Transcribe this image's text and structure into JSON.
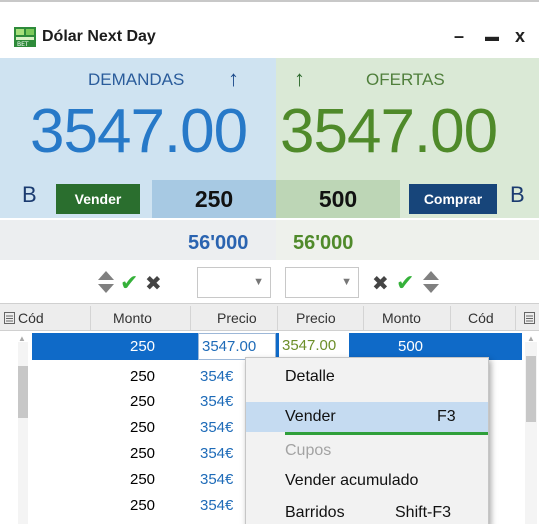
{
  "window": {
    "title": "Dólar Next Day",
    "icon": "bet-logo-icon",
    "minimize_icon": "minimize-icon",
    "maximize_icon": "maximize-icon",
    "close_icon": "close-icon",
    "minimize_glyph": "–",
    "maximize_glyph": "▬",
    "close_glyph": "x"
  },
  "bid": {
    "label": "DEMANDAS",
    "price": "3547.00",
    "badge": "B",
    "button": "Vender",
    "qty": "250",
    "total": "56'000",
    "color": "#2779c8"
  },
  "ask": {
    "label": "OFERTAS",
    "price": "3547.00",
    "badge": "B",
    "button": "Comprar",
    "qty": "500",
    "total": "56'000",
    "color": "#4f8a2a"
  },
  "controls": {
    "check_glyph": "✔",
    "x_glyph": "✖",
    "dropdown_glyph": "▼"
  },
  "grid": {
    "headers": {
      "cod_left": "Cód",
      "monto_left": "Monto",
      "precio_left": "Precio",
      "precio_right": "Precio",
      "monto_right": "Monto",
      "cod_right": "Cód"
    },
    "rows": [
      {
        "monto_bid": "250",
        "precio_bid": "3547.00",
        "precio_ask": "3547.00",
        "monto_ask": "500"
      },
      {
        "monto_bid": "250",
        "precio_bid": "354€"
      },
      {
        "monto_bid": "250",
        "precio_bid": "354€"
      },
      {
        "monto_bid": "250",
        "precio_bid": "354€"
      },
      {
        "monto_bid": "250",
        "precio_bid": "354€"
      },
      {
        "monto_bid": "250",
        "precio_bid": "354€"
      },
      {
        "monto_bid": "250",
        "precio_bid": "354€"
      }
    ]
  },
  "context_menu": {
    "items": [
      {
        "label": "Detalle",
        "shortcut": ""
      },
      {
        "label": "Vender",
        "shortcut": "F3"
      },
      {
        "label": "Cupos",
        "shortcut": ""
      },
      {
        "label": "Vender acumulado",
        "shortcut": ""
      },
      {
        "label": "Barridos",
        "shortcut": "Shift-F3"
      }
    ]
  }
}
